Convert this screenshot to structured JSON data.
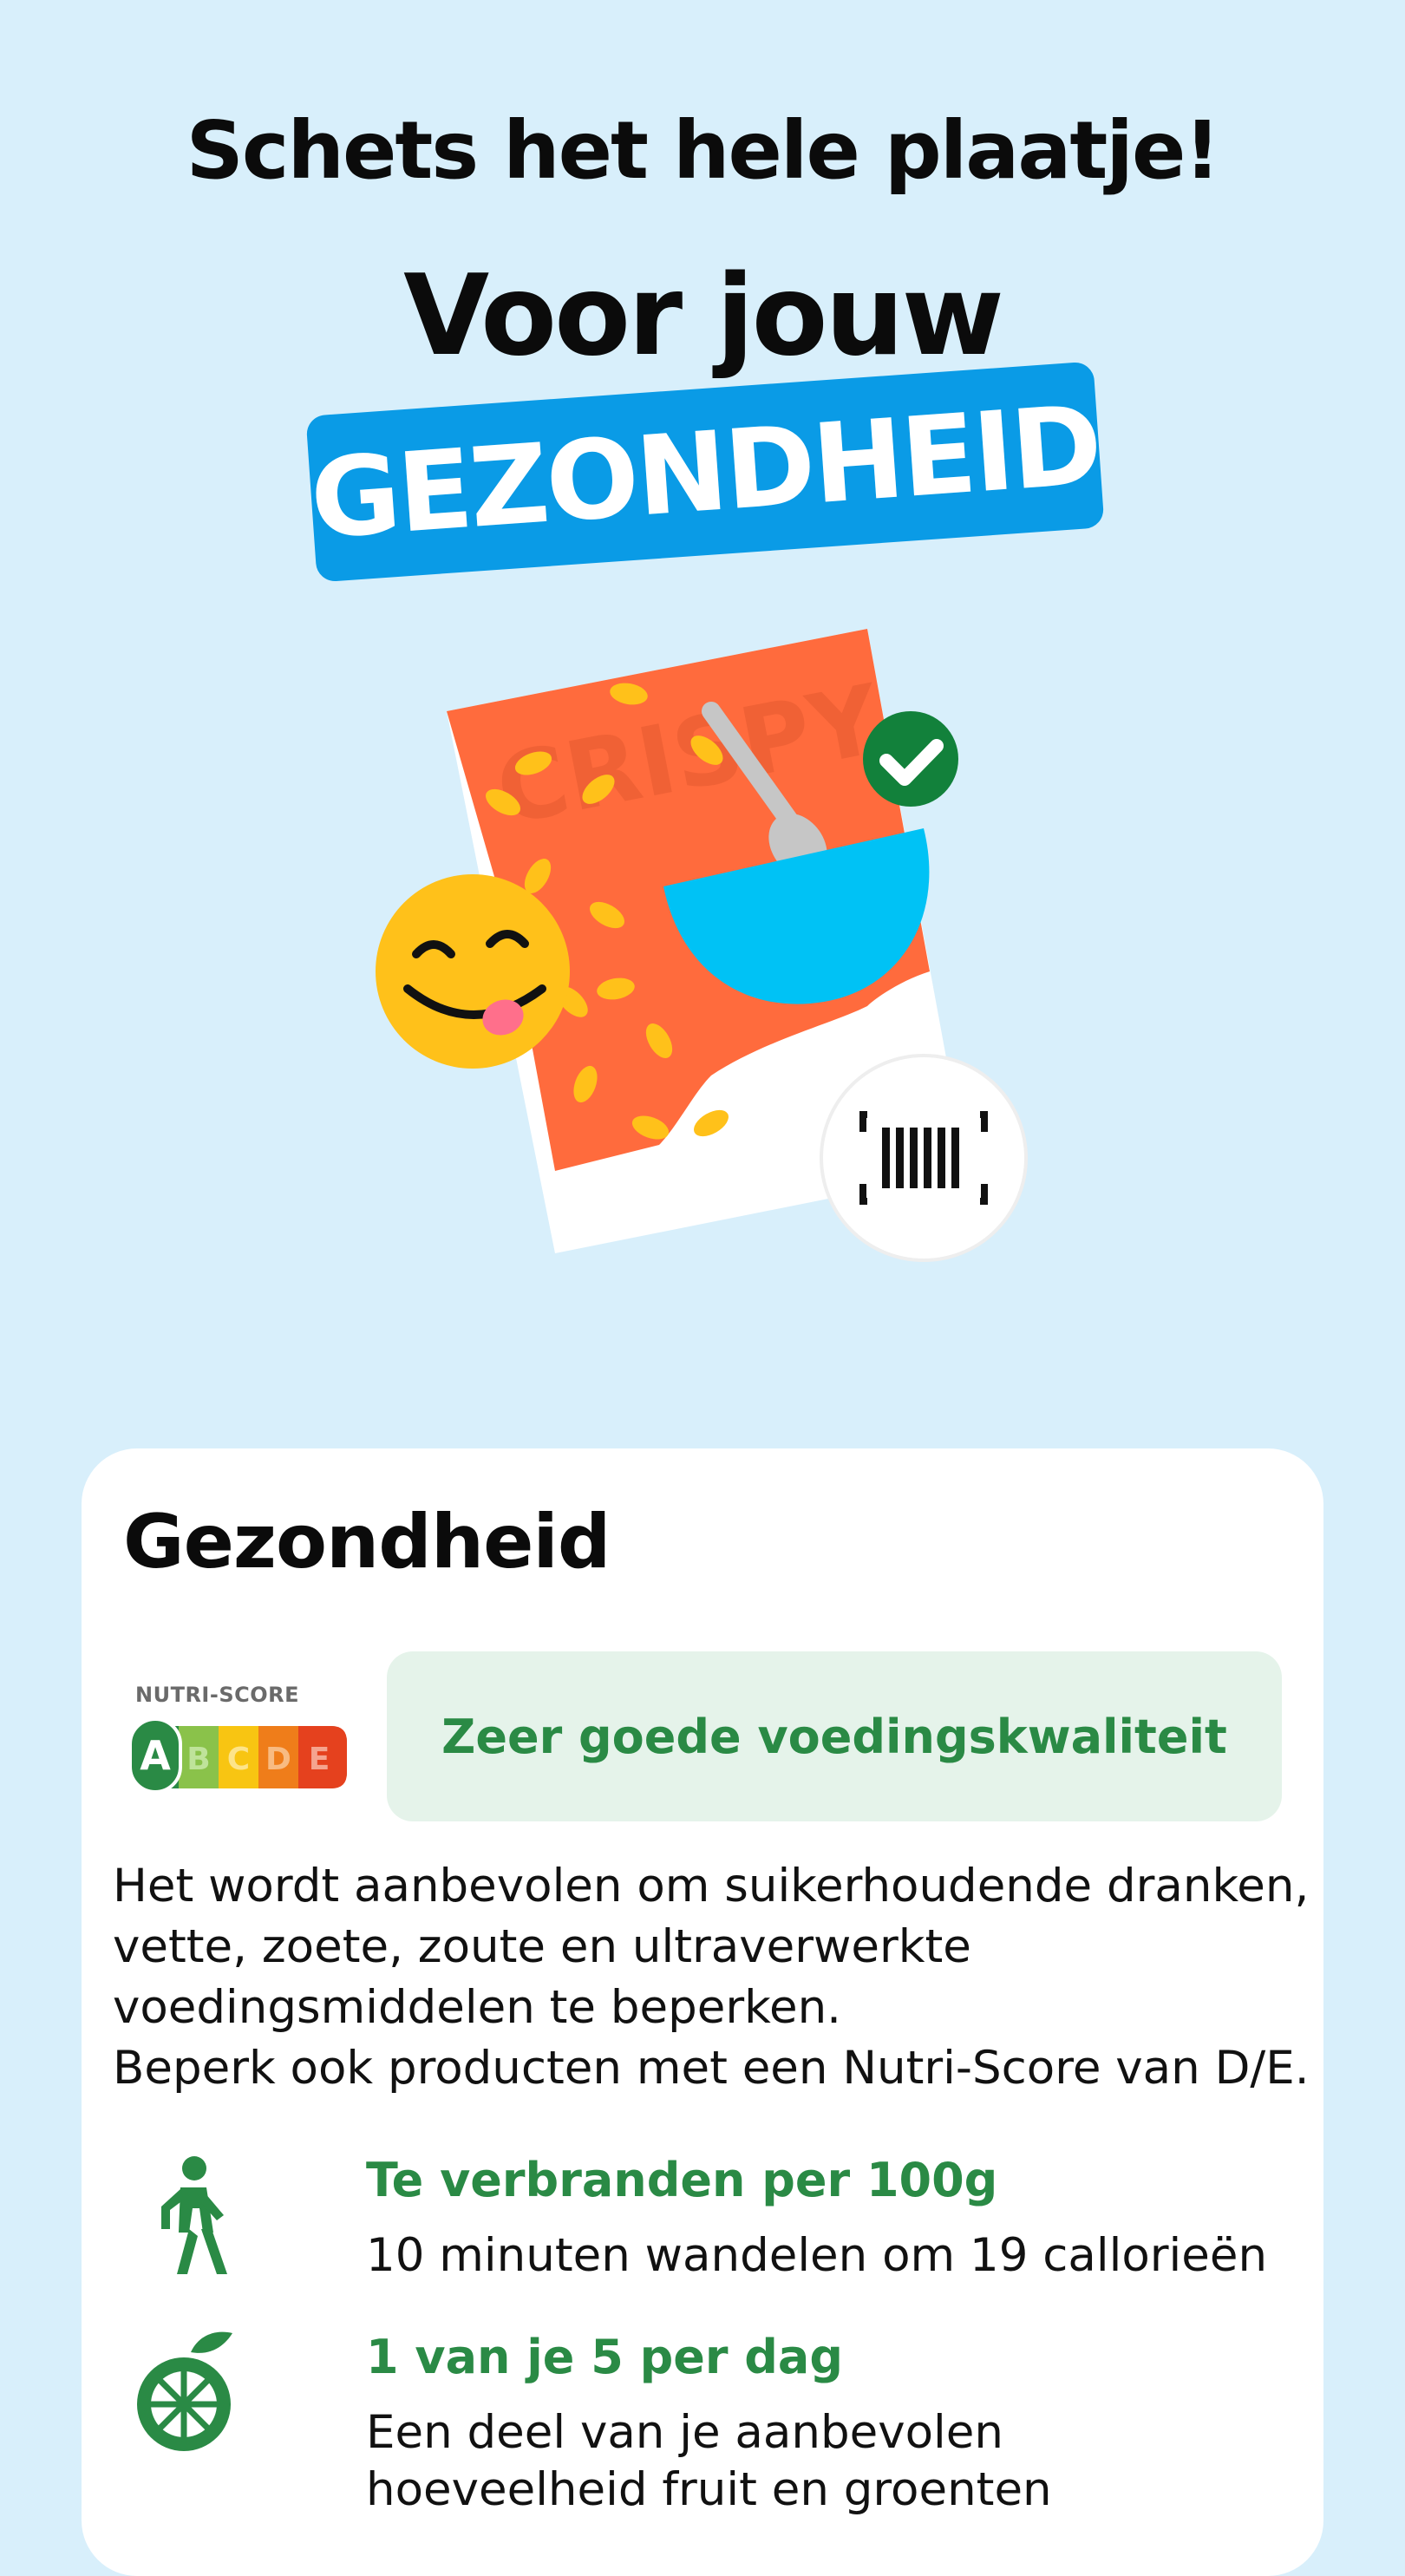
{
  "header": {
    "headline": "Schets het hele plaatje!",
    "title": "Voor jouw",
    "banner": "GEZONDHEID"
  },
  "illustration": {
    "package_text": "CRISPY",
    "icons": [
      "cereal-box-icon",
      "spoon-icon",
      "bowl-icon",
      "check-badge-icon",
      "smiley-tongue-icon",
      "barcode-scan-icon"
    ],
    "colors": {
      "package": "#ff6b3d",
      "bowl": "#00c2f5",
      "check": "#12813b",
      "smiley": "#ffc11a"
    }
  },
  "card": {
    "title": "Gezondheid",
    "nutri_score": {
      "label": "NUTRI-SCORE",
      "letters": [
        "A",
        "B",
        "C",
        "D",
        "E"
      ],
      "selected": "A",
      "colors": [
        "#2a8a45",
        "#8ac24a",
        "#f8c512",
        "#ef7d1a",
        "#e5411e"
      ]
    },
    "quality_label": "Zeer goede voedingskwaliteit",
    "paragraph": [
      "Het wordt aanbevolen om suikerhoudende dranken,",
      "vette, zoete, zoute en ultraverwerkte",
      "voedingsmiddelen te beperken.",
      "Beperk ook producten met een Nutri-Score van D/E."
    ],
    "items": [
      {
        "icon": "walking-person-icon",
        "heading": "Te verbranden per 100g",
        "text": "10 minuten wandelen om 19 callorieën"
      },
      {
        "icon": "fruit-icon",
        "heading": "1 van je 5 per dag",
        "text_lines": [
          "Een deel van je aanbevolen",
          "hoeveelheid fruit en groenten"
        ]
      }
    ]
  }
}
